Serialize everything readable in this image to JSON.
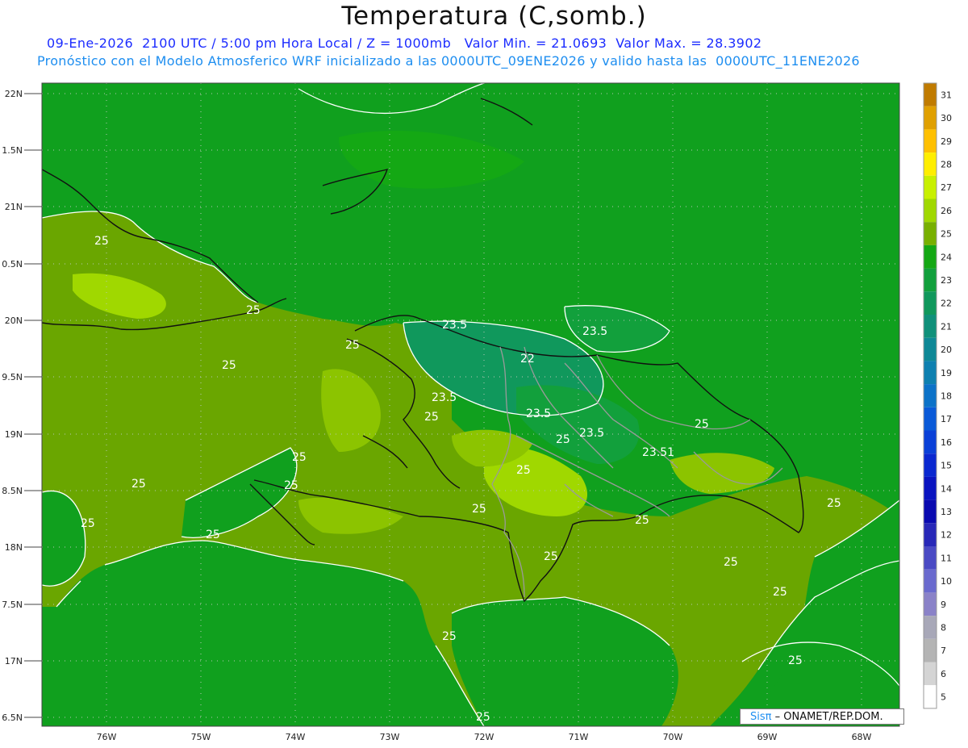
{
  "title": "Temperatura (C,somb.)",
  "subtitle_line1": "09-Ene-2026  2100 UTC / 5:00 pm Hora Local / Z = 1000mb   Valor Min. = 21.0693  Valor Max. = 28.3902",
  "subtitle_line2": "Pronóstico con el Modelo Atmosferico WRF inicializado a las 0000UTC_09ENE2026 y valido hasta las  0000UTC_11ENE2026",
  "lat_labels": [
    "22N",
    "1.5N",
    "21N",
    "0.5N",
    "20N",
    "9.5N",
    "19N",
    "8.5N",
    "18N",
    "7.5N",
    "17N",
    "6.5N"
  ],
  "lon_labels": [
    "76W",
    "75W",
    "74W",
    "73W",
    "72W",
    "71W",
    "70W",
    "69W",
    "68W"
  ],
  "contour_labels": [
    "25",
    "25",
    "25",
    "25",
    "25",
    "25",
    "25",
    "25",
    "25",
    "25",
    "25",
    "25",
    "25",
    "25",
    "25",
    "25",
    "25",
    "25",
    "25",
    "25",
    "23.5",
    "23.5",
    "23.5",
    "23.5",
    "23.5",
    "23.5",
    "23.51",
    "22"
  ],
  "colorbar": {
    "labels": [
      "31",
      "30",
      "29",
      "28",
      "27",
      "26",
      "25",
      "24",
      "23",
      "22",
      "21",
      "20",
      "19",
      "18",
      "17",
      "16",
      "15",
      "14",
      "13",
      "12",
      "11",
      "10",
      "9",
      "8",
      "7",
      "6",
      "5"
    ],
    "colors": [
      "#c07b00",
      "#e0a000",
      "#ffc000",
      "#ffee00",
      "#c8f000",
      "#a0d800",
      "#78b000",
      "#14a814",
      "#12a03c",
      "#10985c",
      "#10907a",
      "#0e8896",
      "#0e80b0",
      "#0c72c8",
      "#0a5ad8",
      "#0a40d8",
      "#0a28d0",
      "#0a14c0",
      "#0a0ab0",
      "#2828b8",
      "#4a4ac4",
      "#6a6ace",
      "#8a82c8",
      "#a8a8b8",
      "#b4b4b4",
      "#d4d4d4",
      "#ffffff"
    ]
  },
  "credit": {
    "sis": "Sisπ",
    "text": "– ONAMET/REP.DOM."
  }
}
